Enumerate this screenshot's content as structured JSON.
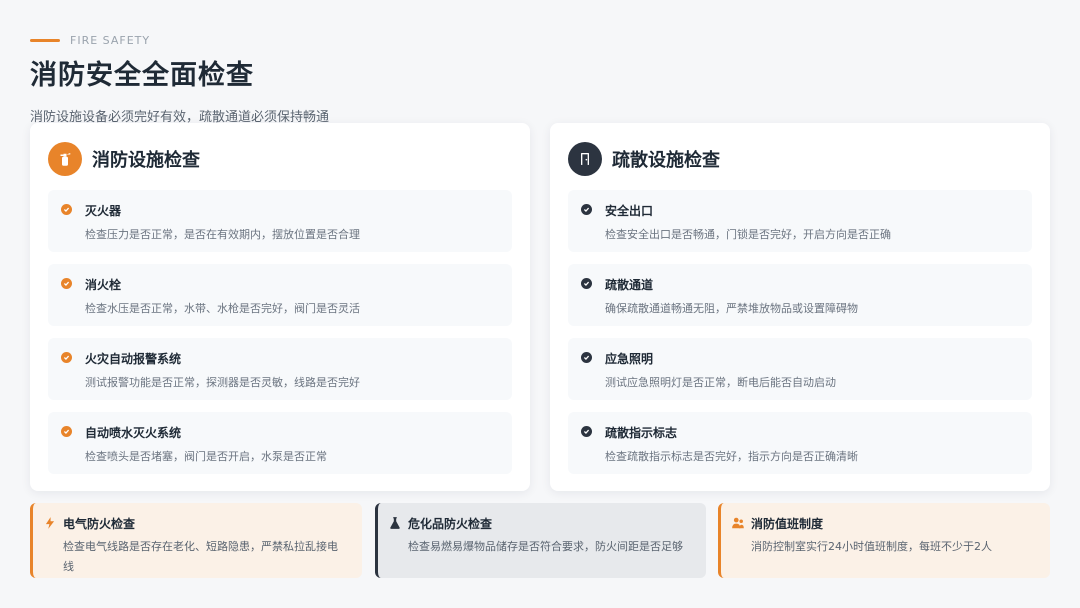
{
  "header": {
    "eyebrow": "FIRE SAFETY",
    "title": "消防安全全面检查",
    "subtitle": "消防设施设备必须完好有效，疏散通道必须保持畅通"
  },
  "colors": {
    "accent": "#e8842a",
    "dark": "#2c3440"
  },
  "left_card": {
    "icon": "fire-extinguisher-icon",
    "title": "消防设施检查",
    "items": [
      {
        "title": "灭火器",
        "desc": "检查压力是否正常，是否在有效期内，摆放位置是否合理"
      },
      {
        "title": "消火栓",
        "desc": "检查水压是否正常，水带、水枪是否完好，阀门是否灵活"
      },
      {
        "title": "火灾自动报警系统",
        "desc": "测试报警功能是否正常，探测器是否灵敏，线路是否完好"
      },
      {
        "title": "自动喷水灭火系统",
        "desc": "检查喷头是否堵塞，阀门是否开启，水泵是否正常"
      }
    ]
  },
  "right_card": {
    "icon": "door-exit-icon",
    "title": "疏散设施检查",
    "items": [
      {
        "title": "安全出口",
        "desc": "检查安全出口是否畅通，门锁是否完好，开启方向是否正确"
      },
      {
        "title": "疏散通道",
        "desc": "确保疏散通道畅通无阻，严禁堆放物品或设置障碍物"
      },
      {
        "title": "应急照明",
        "desc": "测试应急照明灯是否正常，断电后能否自动启动"
      },
      {
        "title": "疏散指示标志",
        "desc": "检查疏散指示标志是否完好，指示方向是否正确清晰"
      }
    ]
  },
  "bottom": [
    {
      "icon": "lightning-icon",
      "title": "电气防火检查",
      "desc": "检查电气线路是否存在老化、短路隐患，严禁私拉乱接电线"
    },
    {
      "icon": "flask-icon",
      "title": "危化品防火检查",
      "desc": "检查易燃易爆物品储存是否符合要求，防火间距是否足够"
    },
    {
      "icon": "users-icon",
      "title": "消防值班制度",
      "desc": "消防控制室实行24小时值班制度，每班不少于2人"
    }
  ]
}
